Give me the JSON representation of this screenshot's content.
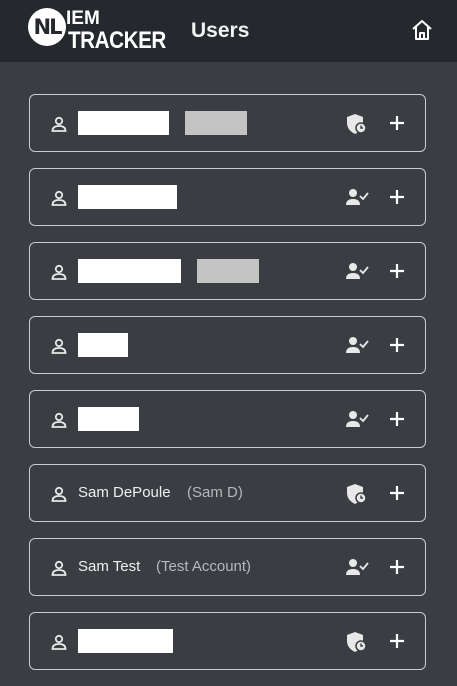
{
  "header": {
    "logo_nl": "NL",
    "logo_line1": "IEM",
    "logo_line2": "TRACKER",
    "title": "Users",
    "home_icon": "home-icon"
  },
  "users": [
    {
      "name": "",
      "alias": "",
      "role_icon": "shield-clock-icon"
    },
    {
      "name": "",
      "alias": "",
      "role_icon": "user-check-icon"
    },
    {
      "name": "",
      "alias": "",
      "role_icon": "user-check-icon"
    },
    {
      "name": "",
      "alias": "",
      "role_icon": "user-check-icon"
    },
    {
      "name": "",
      "alias": "",
      "role_icon": "user-check-icon"
    },
    {
      "name": "Sam DePoule",
      "alias": "(Sam D)",
      "role_icon": "shield-clock-icon"
    },
    {
      "name": "Sam Test",
      "alias": "(Test Account)",
      "role_icon": "user-check-icon"
    },
    {
      "name": "",
      "alias": "",
      "role_icon": "shield-clock-icon"
    }
  ],
  "colors": {
    "background": "#3a3d42",
    "header": "#25282d",
    "border": "#c9cbcf",
    "alias_text": "#b6b8bb"
  }
}
